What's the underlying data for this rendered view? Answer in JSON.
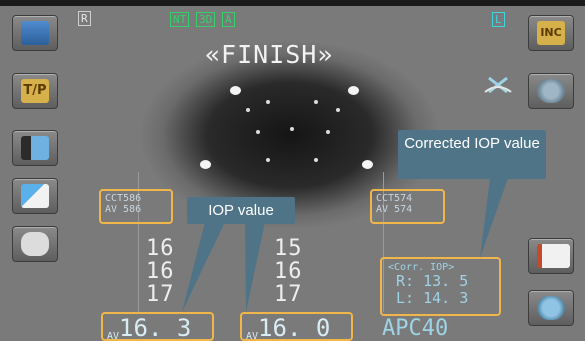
{
  "eye_side": "R",
  "modes": [
    "NT",
    "3D",
    "A"
  ],
  "corner_label": "L",
  "status": "«FINISH»",
  "cct_right": {
    "line1": "CCT586",
    "line2": "AV 586"
  },
  "cct_left": {
    "line1": "CCT574",
    "line2": "AV 574"
  },
  "iop_right": {
    "readings": [
      "16",
      "16",
      "17"
    ],
    "avg_prefix": "AV",
    "avg": "16. 3"
  },
  "iop_left": {
    "readings": [
      "15",
      "16",
      "17"
    ],
    "avg_prefix": "AV",
    "avg": "16. 0"
  },
  "corrected": {
    "title": "<Corr. IOP>",
    "r": "R: 13. 5",
    "l": "L: 14. 3"
  },
  "apc": "APC40",
  "callouts": {
    "iop": "IOP value",
    "corrected": "Corrected IOP value"
  },
  "sidebar_left": [
    "eye-mode-icon",
    "tp-icon",
    "camera-icon",
    "eraser-icon",
    "hand-icon"
  ],
  "sidebar_right": [
    "inc-icon",
    "lens-icon",
    "report-icon",
    "globe-icon"
  ],
  "colors": {
    "highlight": "#f0b64a",
    "callout": "#4f7488",
    "mode_green": "#34d16a",
    "corner_cyan": "#3fd6e0"
  }
}
